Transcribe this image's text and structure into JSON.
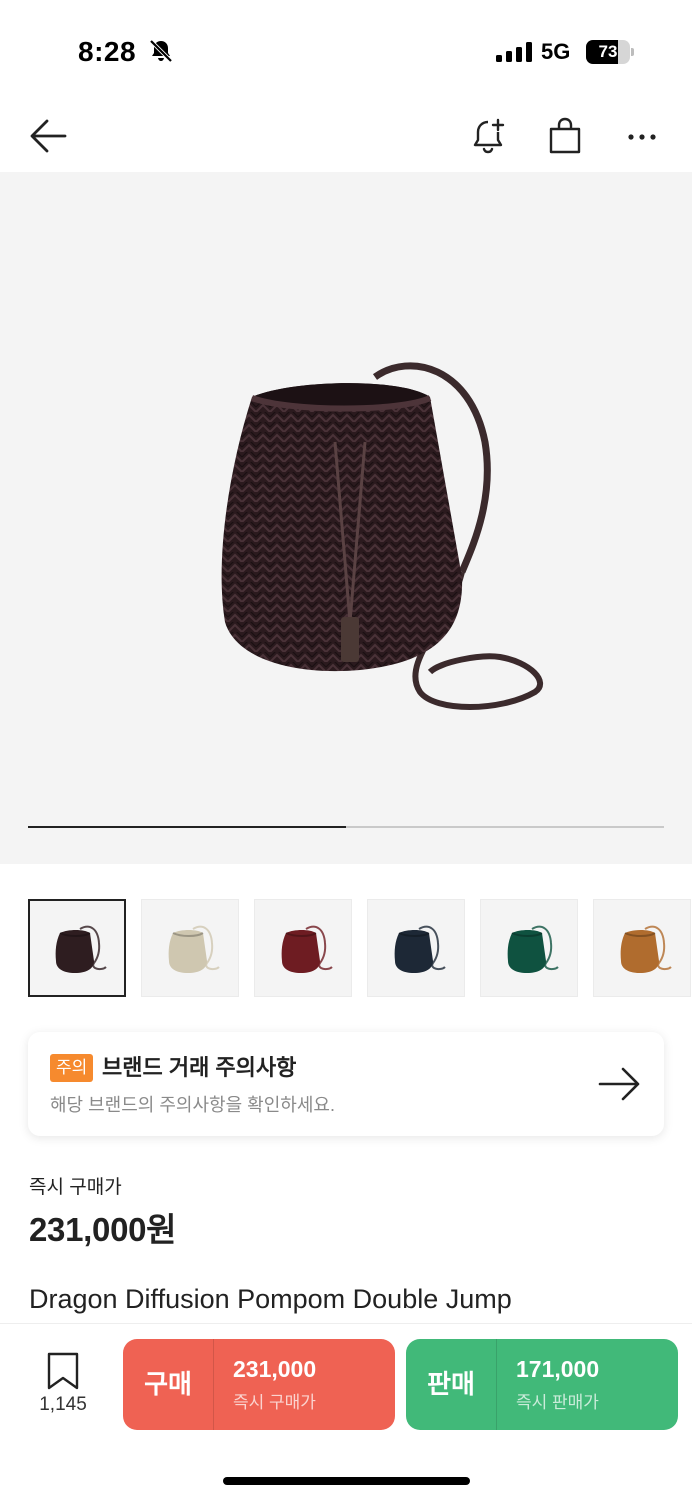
{
  "status_bar": {
    "time": "8:28",
    "network": "5G",
    "battery_percent": "73",
    "battery_level": 0.73
  },
  "nav": {
    "back_icon": "arrow-left-icon",
    "alert_icon": "bell-plus-icon",
    "cart_icon": "shopping-bag-icon",
    "more_icon": "more-horizontal-icon"
  },
  "gallery": {
    "progress_fraction": 0.5,
    "thumbnail_colors": [
      "#2e1d20",
      "#cfc7b0",
      "#6e1c22",
      "#1d2836",
      "#0f5240",
      "#b06c2e"
    ],
    "selected_index": 0
  },
  "notice": {
    "tag": "주의",
    "title": "브랜드 거래 주의사항",
    "description": "해당 브랜드의 주의사항을 확인하세요.",
    "tag_color": "#f68a2e"
  },
  "price": {
    "label": "즉시 구매가",
    "value": "231,000원"
  },
  "product": {
    "name": "Dragon Diffusion Pompom Double Jump"
  },
  "bottom_bar": {
    "wish_count": "1,145",
    "buy": {
      "kind": "구매",
      "price": "231,000",
      "sub": "즉시 구매가",
      "color": "#ef6253"
    },
    "sell": {
      "kind": "판매",
      "price": "171,000",
      "sub": "즉시 판매가",
      "color": "#41b979"
    }
  }
}
